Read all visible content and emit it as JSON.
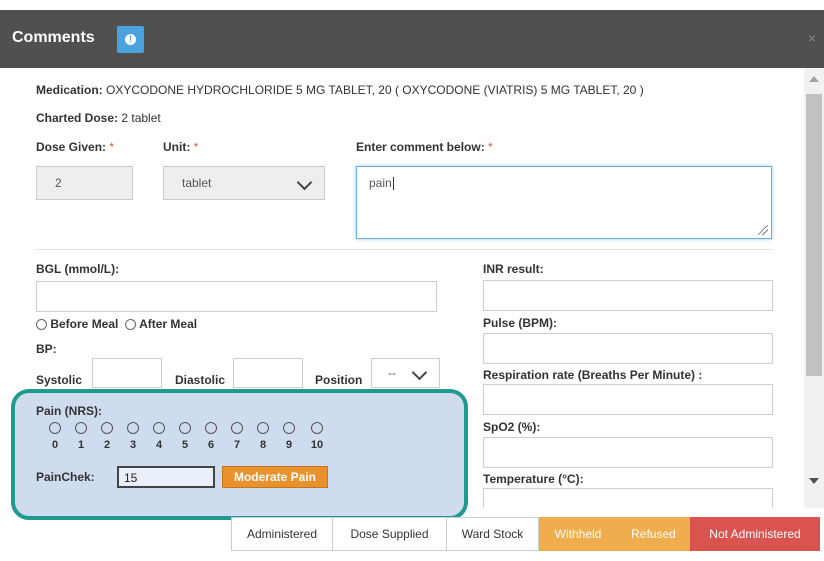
{
  "header": {
    "title": "Comments",
    "info_icon": "info-circle-icon",
    "close_glyph": "×"
  },
  "medication": {
    "label": "Medication:",
    "value": "OXYCODONE HYDROCHLORIDE 5 MG TABLET, 20 ( OXYCODONE (VIATRIS) 5 MG TABLET, 20 )"
  },
  "charted_dose": {
    "label": "Charted Dose:",
    "value": "2 tablet"
  },
  "dose_given": {
    "label": "Dose Given:",
    "required_mark": "*",
    "value": "2"
  },
  "unit": {
    "label": "Unit:",
    "required_mark": "*",
    "selected": "tablet"
  },
  "comment": {
    "label": "Enter comment below:",
    "required_mark": "*",
    "value": "pain"
  },
  "bgl": {
    "label": "BGL (mmol/L):",
    "value": ""
  },
  "meal_options": [
    "Before Meal",
    "After Meal"
  ],
  "bp": {
    "label": "BP:",
    "systolic_label": "Systolic",
    "diastolic_label": "Diastolic",
    "position_label": "Position",
    "position_selected": "--"
  },
  "pain": {
    "label": "Pain (NRS):",
    "scale": [
      "0",
      "1",
      "2",
      "3",
      "4",
      "5",
      "6",
      "7",
      "8",
      "9",
      "10"
    ],
    "painchek_label": "PainChek:",
    "painchek_value": "15",
    "painchek_result": "Moderate Pain"
  },
  "vitals_right": {
    "inr": "INR result:",
    "pulse": "Pulse (BPM):",
    "respiration": "Respiration rate (Breaths Per Minute) :",
    "spo2": "SpO2 (%):",
    "temperature": "Temperature (°C):"
  },
  "footer_buttons": {
    "administered": "Administered",
    "dose_supplied": "Dose Supplied",
    "ward_stock": "Ward Stock",
    "withheld": "Withheld",
    "refused": "Refused",
    "not_administered": "Not Administered"
  },
  "colors": {
    "header_bg": "#505050",
    "info_button": "#4aa3df",
    "highlight_border": "#1e9a8e",
    "highlight_fill": "#cfdcef",
    "pain_badge": "#e8912d",
    "withheld": "#f0ad4e",
    "not_administered": "#d9534f"
  }
}
